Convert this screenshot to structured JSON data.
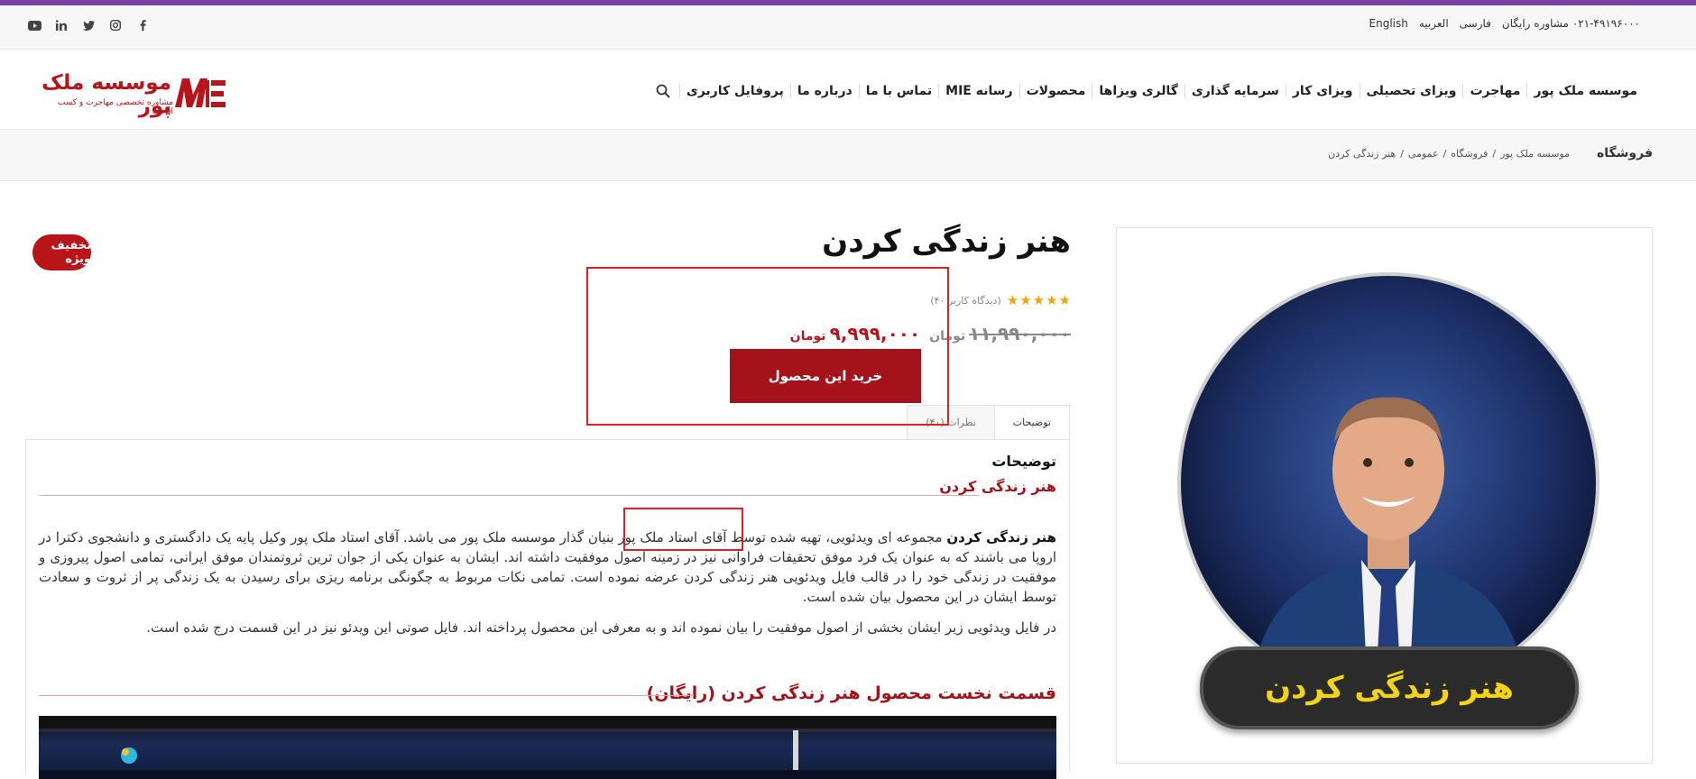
{
  "topbar": {
    "links": [
      "English",
      "العربیه",
      "فارسی",
      "۰۲۱-۴۹۱۹۶۰۰۰ مشاوره رایگان"
    ]
  },
  "logo": {
    "name": "موسسه ملک پور",
    "tagline": "مشاوره تخصصی مهاجرت و کسب اقامت"
  },
  "nav": {
    "items": [
      "موسسه ملک پور",
      "مهاجرت",
      "ویزای تحصیلی",
      "ویزای کار",
      "سرمایه گذاری",
      "گالری ویزاها",
      "محصولات",
      "رسانه MIE",
      "تماس با ما",
      "درباره ما",
      "پروفایل کاربری"
    ]
  },
  "breadcrumb": {
    "page_title": "فروشگاه",
    "items": [
      "موسسه ملک پور",
      "فروشگاه",
      "عمومی",
      "هنر زندگی کردن"
    ],
    "separator": "/"
  },
  "product": {
    "title": "هنر زندگی کردن",
    "image_banner": "هنر زندگی کردن",
    "badge": "تخفیف ویژه",
    "rating_stars": 5,
    "review_count": "(دیدگاه کاربر ۴۰)",
    "old_price": "۱۱,۹۹۰,۰۰۰",
    "new_price": "۹,۹۹۹,۰۰۰",
    "currency": "تومان",
    "buy_label": "خرید این محصول"
  },
  "tabs": [
    {
      "label": "توضیحات",
      "active": true
    },
    {
      "label": "نظرات (۴۰)",
      "active": false
    }
  ],
  "description": {
    "heading": "توضیحات",
    "subheading": "هنر زندگی کردن",
    "para1_bold": "هنر زندگی کردن",
    "para1_rest": " مجموعه ای ویدئویی، تهیه شده توسط آقای استاد ملک پور بنیان گذار موسسه ملک پور می باشد. آقای استاد ملک پور وکیل پایه یک دادگستری و دانشجوی دکترا در اروپا می باشند که به عنوان یک فرد موفق تحقیقات فراوانی نیز در زمینه اصول موفقیت داشته اند. ایشان به عنوان یکی از جوان ترین ثروتمندان موفق ایرانی، تمامی اصول پیروزی و موفقیت در زندگی خود را در قالب فایل ویدئویی هنر زندگی کردن عرضه نموده است. تمامی نکات مربوط به چگونگی برنامه ریزی برای رسیدن به یک زندگی پر از ثروت و سعادت توسط ایشان در این محصول بیان شده است.",
    "para2": "در فایل ویدئویی زیر ایشان بخشی از اصول موفقیت را بیان نموده اند و به معرفی این محصول پرداخته اند. فایل صوتی این ویدئو نیز در این قسمت درج شده است.",
    "section_title": "قسمت نخست محصول هنر زندگی کردن (رایگان)"
  },
  "colors": {
    "accent": "#b8151b",
    "topbar_stripe": "#7b3fa6",
    "star": "#f0a500",
    "banner_text": "#f3d317"
  }
}
